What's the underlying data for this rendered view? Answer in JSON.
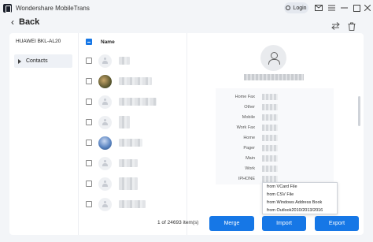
{
  "app": {
    "title": "Wondershare MobileTrans",
    "login_label": "Login"
  },
  "nav": {
    "back_label": "Back"
  },
  "sidebar": {
    "device": "HUAWEI BKL-AL20",
    "items": [
      {
        "label": "Contacts"
      }
    ]
  },
  "list": {
    "name_header": "Name"
  },
  "detail": {
    "fields": [
      {
        "label": "Home Fax"
      },
      {
        "label": "Other"
      },
      {
        "label": "Mobile"
      },
      {
        "label": "Work Fax"
      },
      {
        "label": "Home"
      },
      {
        "label": "Pager"
      },
      {
        "label": "Main"
      },
      {
        "label": "Work"
      },
      {
        "label": "IPHONE"
      }
    ]
  },
  "footer": {
    "count_text": "1 of 24693 item(s)",
    "merge_label": "Merge",
    "import_label": "Import",
    "export_label": "Export"
  },
  "import_menu": {
    "items": [
      {
        "label": "from VCard File"
      },
      {
        "label": "from CSV File"
      },
      {
        "label": "from Windows Address  Book"
      },
      {
        "label": "from Outlook2010/2013/2016"
      }
    ]
  },
  "colors": {
    "accent": "#1677e6",
    "background": "#f3f5f8"
  }
}
